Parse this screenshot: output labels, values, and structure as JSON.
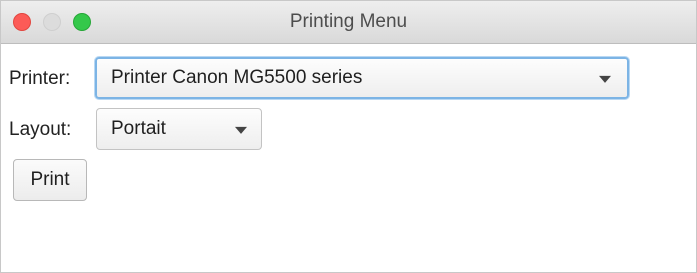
{
  "window": {
    "title": "Printing Menu"
  },
  "form": {
    "printer_label": "Printer:",
    "printer_value": "Printer Canon MG5500 series",
    "layout_label": "Layout:",
    "layout_value": "Portait",
    "print_button": "Print"
  },
  "colors": {
    "close": "#fc5b57",
    "minimize": "#dcdcdc",
    "zoom": "#34c84a",
    "focus_ring": "#7cb4e5"
  }
}
